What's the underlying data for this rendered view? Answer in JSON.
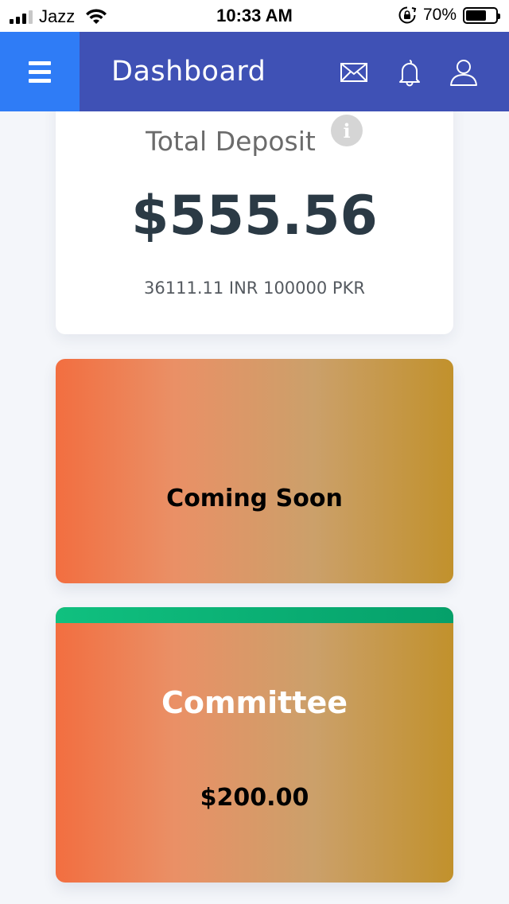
{
  "status_bar": {
    "carrier": "Jazz",
    "time": "10:33 AM",
    "battery": "70%",
    "battery_level": 0.7,
    "icons": [
      "signal-bars-icon",
      "wifi-icon",
      "rotation-lock-icon",
      "battery-icon"
    ]
  },
  "header": {
    "title": "Dashboard",
    "background": "#3f51b5",
    "menu_background": "#2f7cf6",
    "icons": [
      "menu-icon",
      "mail-icon",
      "bell-icon",
      "user-icon"
    ]
  },
  "deposit": {
    "title": "Total Deposit",
    "info_glyph": "i",
    "amount": "$555.56",
    "conversion": "36111.11 INR 100000 PKR"
  },
  "coming_soon": {
    "label": "Coming Soon"
  },
  "committee": {
    "title": "Committee",
    "amount": "$200.00"
  },
  "colors": {
    "gradient_start": "#f26e40",
    "gradient_end": "#c1912c",
    "committee_bar": "#10c07f"
  }
}
